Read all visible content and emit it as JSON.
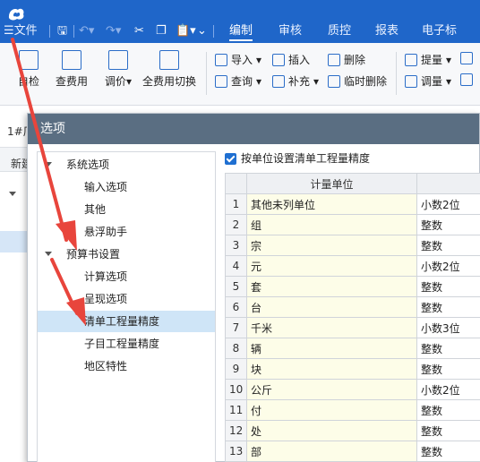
{
  "menubar": {
    "file_label": "☰文件",
    "tabs": [
      "编制",
      "审核",
      "质控",
      "报表",
      "电子标"
    ],
    "active_tab": "编制"
  },
  "ribbon": {
    "big_buttons": [
      "自检",
      "查费用",
      "调价",
      "全费用切换"
    ],
    "small_buttons": [
      {
        "label": "导入"
      },
      {
        "label": "插入"
      },
      {
        "label": "删除"
      },
      {
        "label": "查询"
      },
      {
        "label": "补充"
      },
      {
        "label": "临时删除"
      },
      {
        "label": "提量"
      },
      {
        "label": "调量"
      }
    ]
  },
  "background": {
    "tab_label": "1#厂",
    "row_label": "新建"
  },
  "dialog": {
    "title": "选项",
    "tree": [
      {
        "label": "系统选项",
        "level": 0,
        "expanded": true
      },
      {
        "label": "输入选项",
        "level": 1
      },
      {
        "label": "其他",
        "level": 1
      },
      {
        "label": "悬浮助手",
        "level": 1
      },
      {
        "label": "预算书设置",
        "level": 0,
        "expanded": true
      },
      {
        "label": "计算选项",
        "level": 1
      },
      {
        "label": "呈现选项",
        "level": 1
      },
      {
        "label": "清单工程量精度",
        "level": 1,
        "selected": true
      },
      {
        "label": "子目工程量精度",
        "level": 1
      },
      {
        "label": "地区特性",
        "level": 1
      }
    ],
    "checkbox_label": "按单位设置清单工程量精度",
    "table": {
      "headers": [
        "",
        "计量单位",
        ""
      ],
      "rows": [
        {
          "no": "1",
          "unit": "其他未列单位",
          "precision": "小数2位"
        },
        {
          "no": "2",
          "unit": "组",
          "precision": "整数"
        },
        {
          "no": "3",
          "unit": "宗",
          "precision": "整数"
        },
        {
          "no": "4",
          "unit": "元",
          "precision": "小数2位"
        },
        {
          "no": "5",
          "unit": "套",
          "precision": "整数"
        },
        {
          "no": "6",
          "unit": "台",
          "precision": "整数"
        },
        {
          "no": "7",
          "unit": "千米",
          "precision": "小数3位"
        },
        {
          "no": "8",
          "unit": "辆",
          "precision": "整数"
        },
        {
          "no": "9",
          "unit": "块",
          "precision": "整数"
        },
        {
          "no": "10",
          "unit": "公斤",
          "precision": "小数2位"
        },
        {
          "no": "11",
          "unit": "付",
          "precision": "整数"
        },
        {
          "no": "12",
          "unit": "处",
          "precision": "整数"
        },
        {
          "no": "13",
          "unit": "部",
          "precision": "整数"
        }
      ]
    }
  },
  "colors": {
    "titlebar": "#1f66c9",
    "arrow": "#e8453c",
    "selected_row": "#cfe5f7",
    "unit_cell": "#fdfde8"
  }
}
